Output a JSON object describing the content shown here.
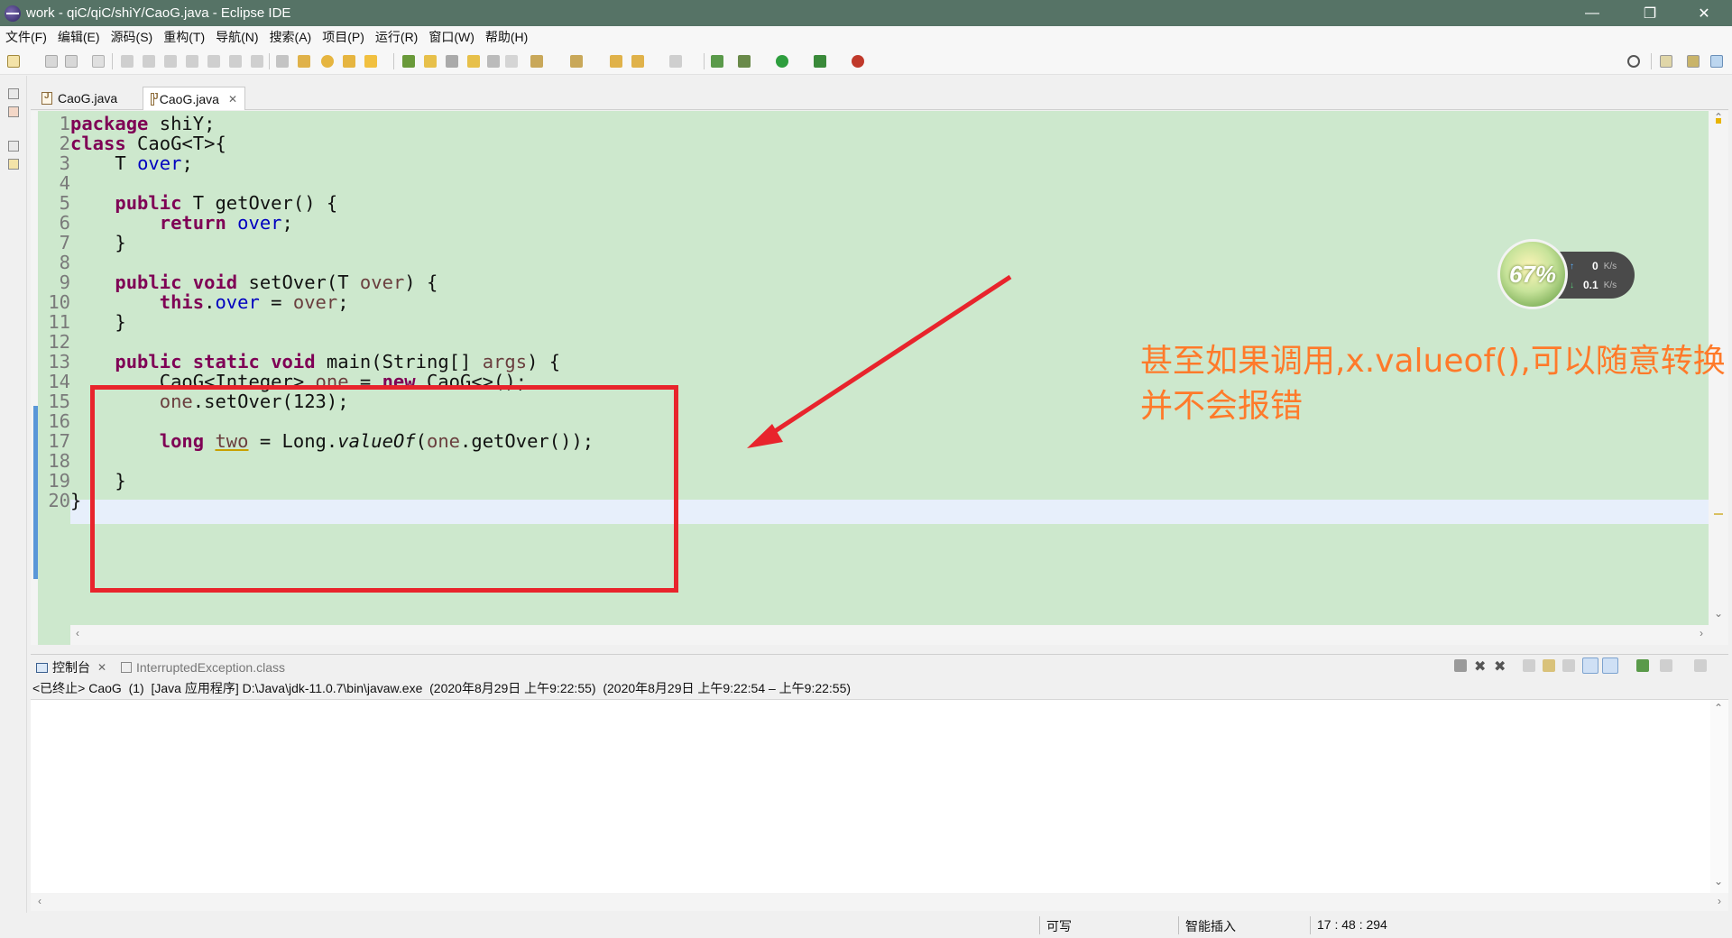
{
  "window": {
    "title": "work - qiC/qiC/shiY/CaoG.java - Eclipse IDE",
    "controls": {
      "minimize": "—",
      "restore": "❐",
      "close": "✕"
    }
  },
  "menu": [
    "文件(F)",
    "编辑(E)",
    "源码(S)",
    "重构(T)",
    "导航(N)",
    "搜索(A)",
    "项目(P)",
    "运行(R)",
    "窗口(W)",
    "帮助(H)"
  ],
  "editor_tabs": [
    {
      "label": "CaoG.java",
      "active": false
    },
    {
      "label": "CaoG.java",
      "active": true,
      "close": "✕"
    }
  ],
  "code_lines": [
    {
      "no": "1",
      "html": "<span class=\"kw\">package</span> shiY;"
    },
    {
      "no": "2",
      "html": "<span class=\"kw\">class</span> CaoG&lt;T&gt;{"
    },
    {
      "no": "3",
      "html": "    T <span class=\"fld\">over</span>;"
    },
    {
      "no": "4",
      "html": ""
    },
    {
      "no": "5",
      "html": "    <span class=\"kw\">public</span> T getOver() {"
    },
    {
      "no": "6",
      "html": "        <span class=\"kw\">return</span> <span class=\"fld\">over</span>;"
    },
    {
      "no": "7",
      "html": "    }"
    },
    {
      "no": "8",
      "html": ""
    },
    {
      "no": "9",
      "html": "    <span class=\"kw\">public</span> <span class=\"kw\">void</span> setOver(T <span class=\"prm\">over</span>) {"
    },
    {
      "no": "10",
      "html": "        <span class=\"kw\">this</span>.<span class=\"fld\">over</span> = <span class=\"prm\">over</span>;"
    },
    {
      "no": "11",
      "html": "    }"
    },
    {
      "no": "12",
      "html": ""
    },
    {
      "no": "13",
      "html": "    <span class=\"kw\">public</span> <span class=\"kw\">static</span> <span class=\"kw\">void</span> main(String[] <span class=\"prm\">args</span>) {"
    },
    {
      "no": "14",
      "html": "        CaoG&lt;Integer&gt; <span class=\"var\">one</span> = <span class=\"kw\">new</span> CaoG&lt;&gt;();"
    },
    {
      "no": "15",
      "html": "        <span class=\"var\">one</span>.setOver(123);"
    },
    {
      "no": "16",
      "html": ""
    },
    {
      "no": "17",
      "html": "        <span class=\"kw\">long</span> <span class=\"var warn-underline\">two</span> = Long.<span class=\"static-call\">valueOf</span>(<span class=\"var\">one</span>.getOver());"
    },
    {
      "no": "18",
      "html": ""
    },
    {
      "no": "19",
      "html": "    }"
    },
    {
      "no": "20",
      "html": "}"
    }
  ],
  "annotation": {
    "line1": "甚至如果调用,x.valueof(),可以随意转换",
    "line2": "并不会报错"
  },
  "net_widget": {
    "percent": "67%",
    "upload": "0",
    "upload_unit": "K/s",
    "download": "0.1",
    "download_unit": "K/s"
  },
  "console": {
    "tabs": [
      {
        "label": "控制台",
        "close": "✕"
      },
      {
        "label": "InterruptedException.class"
      }
    ],
    "description": "<已终止> CaoG  (1)  [Java 应用程序] D:\\Java\\jdk-11.0.7\\bin\\javaw.exe  (2020年8月29日 上午9:22:55)  (2020年8月29日 上午9:22:54 – 上午9:22:55)"
  },
  "status": {
    "writable": "可写",
    "insert_mode": "智能插入",
    "position": "17 : 48 : 294"
  },
  "colors": {
    "titlebar": "#567366",
    "editor_bg": "#cde8cd",
    "highlight_box": "#e8242c",
    "annotation": "#ff7a2a"
  }
}
